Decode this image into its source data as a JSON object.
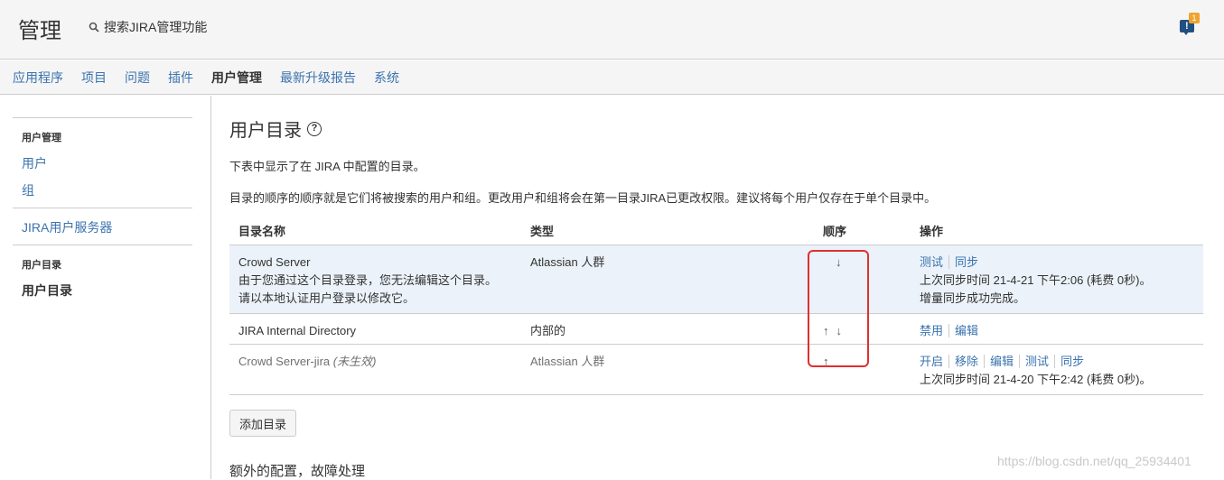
{
  "header": {
    "title": "管理",
    "search_label": "搜索JIRA管理功能",
    "notification_count": "1"
  },
  "nav": {
    "items": [
      "应用程序",
      "项目",
      "问题",
      "插件",
      "用户管理",
      "最新升级报告",
      "系统"
    ],
    "active": "用户管理"
  },
  "sidebar": {
    "group1_heading": "用户管理",
    "link_users": "用户",
    "link_groups": "组",
    "link_jira_server": "JIRA用户服务器",
    "group2_heading": "用户目录",
    "link_directories": "用户目录"
  },
  "main": {
    "title": "用户目录",
    "desc1": "下表中显示了在 JIRA 中配置的目录。",
    "desc2": "目录的顺序的顺序就是它们将被搜索的用户和组。更改用户和组将会在第一目录JIRA已更改权限。建议将每个用户仅存在于单个目录中。",
    "table": {
      "headers": [
        "目录名称",
        "类型",
        "顺序",
        "操作"
      ],
      "rows": [
        {
          "name": "Crowd Server",
          "note": "由于您通过这个目录登录，您无法编辑这个目录。请以本地认证用户登录以修改它。",
          "type": "Atlassian 人群",
          "order_arrows": [
            "down"
          ],
          "ops": [
            "测试",
            "同步"
          ],
          "sync_info": "上次同步时间 21-4-21 下午2:06 (耗费 0秒)。",
          "sync_status": "增量同步成功完成。"
        },
        {
          "name": "JIRA Internal Directory",
          "type": "内部的",
          "order_arrows": [
            "up",
            "down"
          ],
          "ops": [
            "禁用",
            "编辑"
          ]
        },
        {
          "name": "Crowd Server-jira",
          "name_suffix": "(未生效)",
          "type": "Atlassian 人群",
          "order_arrows": [
            "up"
          ],
          "ops": [
            "开启",
            "移除",
            "编辑",
            "测试",
            "同步"
          ],
          "sync_info": "上次同步时间 21-4-20 下午2:42 (耗费 0秒)。"
        }
      ]
    },
    "add_button": "添加目录",
    "section2_title": "额外的配置，故障处理"
  },
  "watermark": "https://blog.csdn.net/qq_25934401",
  "colors": {
    "link": "#3b73af",
    "highlight_row": "#ebf2f9",
    "annotation_box": "#e03030"
  }
}
